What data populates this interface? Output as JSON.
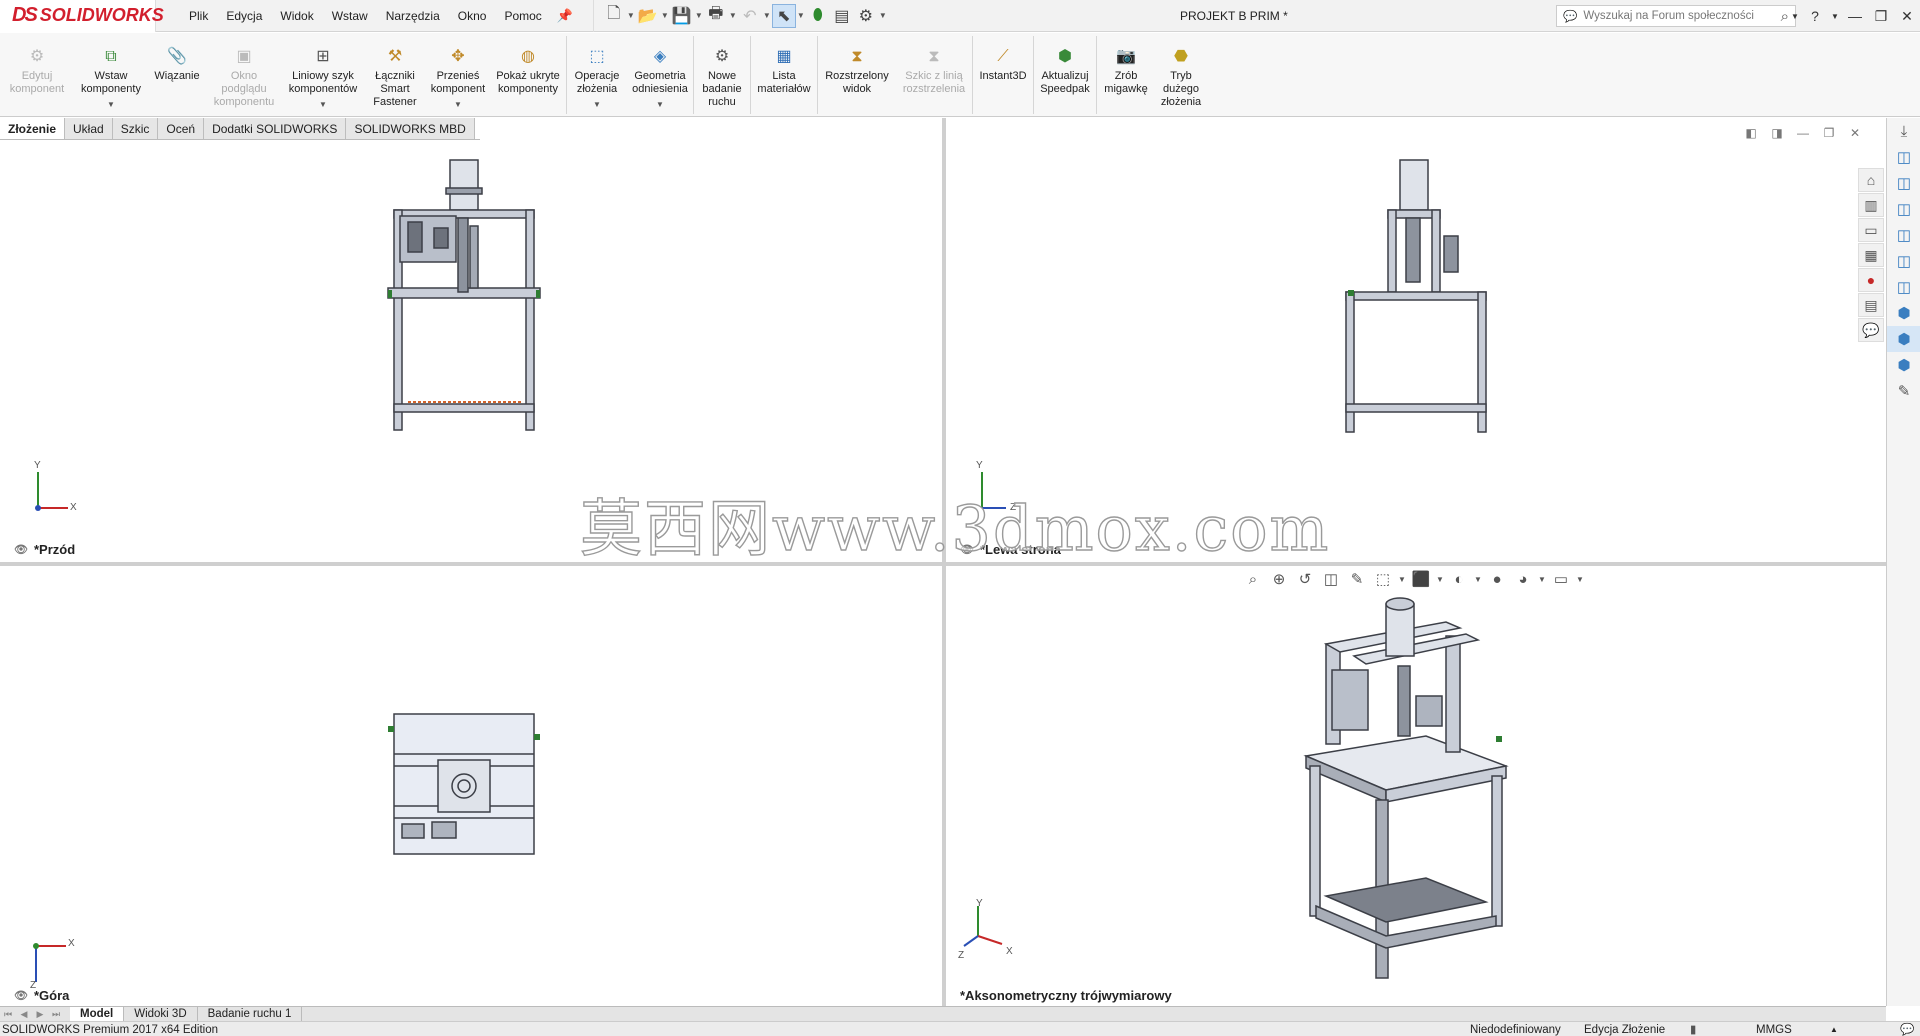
{
  "app": {
    "logo_text": "SOLIDWORKS",
    "logo_mark": "DS",
    "document_title": "PROJEKT B PRIM *"
  },
  "menu": [
    "Plik",
    "Edycja",
    "Widok",
    "Wstaw",
    "Narzędzia",
    "Okno",
    "Pomoc"
  ],
  "search": {
    "placeholder": "Wyszukaj na Forum społeczności"
  },
  "ribbon": [
    {
      "label": "Edytuj komponent",
      "enabled": false
    },
    {
      "label": "Wstaw komponenty",
      "enabled": true,
      "dropdown": true
    },
    {
      "label": "Wiązanie",
      "enabled": true
    },
    {
      "label": "Okno podglądu komponentu",
      "enabled": false
    },
    {
      "label": "Liniowy szyk komponentów",
      "enabled": true,
      "dropdown": true
    },
    {
      "label": "Łączniki Smart Fastener",
      "enabled": true
    },
    {
      "label": "Przenieś komponent",
      "enabled": true,
      "dropdown": true
    },
    {
      "label": "Pokaż ukryte komponenty",
      "enabled": true
    },
    {
      "label": "Operacje złożenia",
      "enabled": true,
      "dropdown": true
    },
    {
      "label": "Geometria odniesienia",
      "enabled": true,
      "dropdown": true
    },
    {
      "label": "Nowe badanie ruchu",
      "enabled": true
    },
    {
      "label": "Lista materiałów",
      "enabled": true
    },
    {
      "label": "Rozstrzelony widok",
      "enabled": true
    },
    {
      "label": "Szkic z linią rozstrzelenia",
      "enabled": false
    },
    {
      "label": "Instant3D",
      "enabled": true
    },
    {
      "label": "Aktualizuj Speedpak",
      "enabled": true
    },
    {
      "label": "Zrób migawkę",
      "enabled": true
    },
    {
      "label": "Tryb dużego złożenia",
      "enabled": true
    }
  ],
  "command_tabs": [
    "Złożenie",
    "Układ",
    "Szkic",
    "Oceń",
    "Dodatki SOLIDWORKS",
    "SOLIDWORKS MBD"
  ],
  "active_command_tab": "Złożenie",
  "viewports": {
    "front": {
      "label": "*Przód",
      "axes": [
        "Y",
        "X"
      ]
    },
    "left": {
      "label": "*Lewa strona",
      "axes": [
        "Y",
        "Z"
      ]
    },
    "top": {
      "label": "*Góra",
      "axes": [
        "X",
        "Z"
      ]
    },
    "iso": {
      "label": "*Aksonometryczny trójwymiarowy",
      "axes": [
        "Y",
        "X",
        "Z"
      ]
    }
  },
  "watermark": "莫西网www.3dmox.com",
  "bottom_tabs": [
    "Model",
    "Widoki 3D",
    "Badanie ruchu 1"
  ],
  "active_bottom_tab": "Model",
  "status": {
    "edition": "SOLIDWORKS Premium 2017 x64 Edition",
    "definition": "Niedodefiniowany",
    "mode": "Edycja Złożenie",
    "units": "MMGS"
  },
  "colors": {
    "brand": "#d21f2d",
    "frame": "#5a5d66",
    "plate": "#e8ecf4",
    "accent": "#3a7ec0"
  }
}
